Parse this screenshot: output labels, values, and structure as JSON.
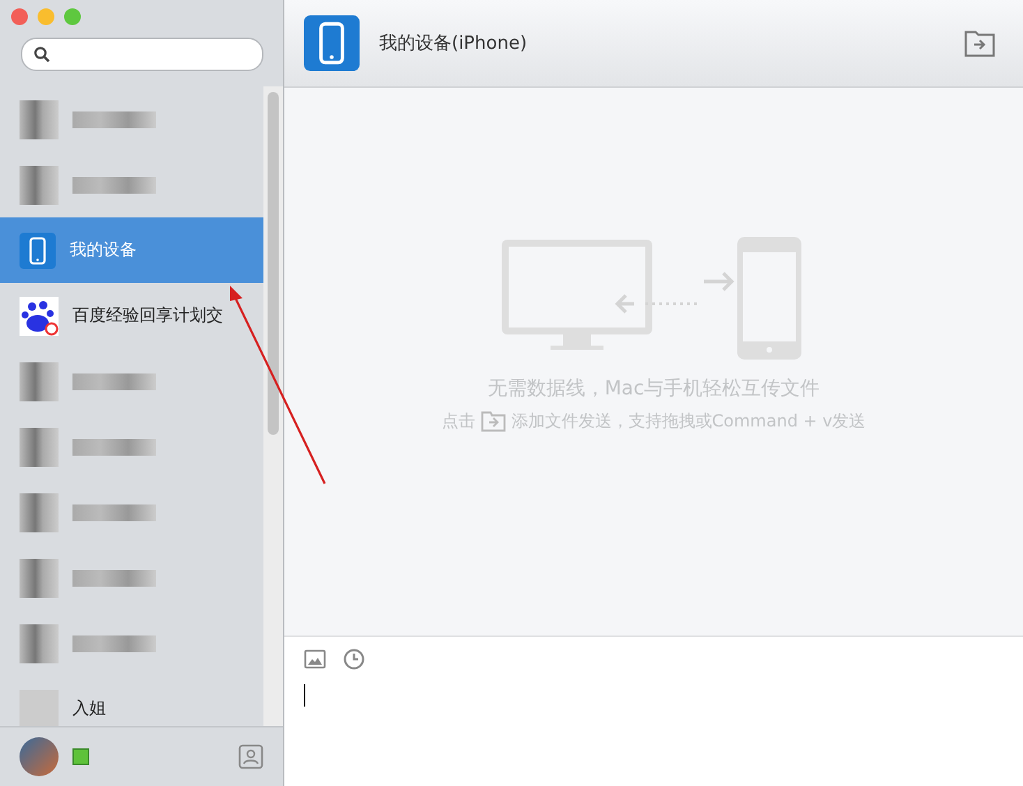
{
  "contacts": [
    {
      "kind": "blurred",
      "selected": false
    },
    {
      "kind": "blurred",
      "selected": false
    },
    {
      "kind": "device",
      "name": "我的设备",
      "selected": true
    },
    {
      "kind": "badge",
      "name": "百度经验回享计划交",
      "selected": false
    },
    {
      "kind": "blurred",
      "selected": false
    },
    {
      "kind": "blurred",
      "selected": false
    },
    {
      "kind": "blurred",
      "selected": false
    },
    {
      "kind": "blurred",
      "selected": false
    },
    {
      "kind": "blurred",
      "selected": false
    },
    {
      "kind": "person",
      "name": "入姐",
      "selected": false
    }
  ],
  "status": {
    "online": true
  },
  "header": {
    "title": "我的设备(iPhone)"
  },
  "empty_state": {
    "headline": "无需数据线，Mac与手机轻松互传文件",
    "hint_before": "点击",
    "hint_after": "添加文件发送，支持拖拽或Command + v发送"
  }
}
